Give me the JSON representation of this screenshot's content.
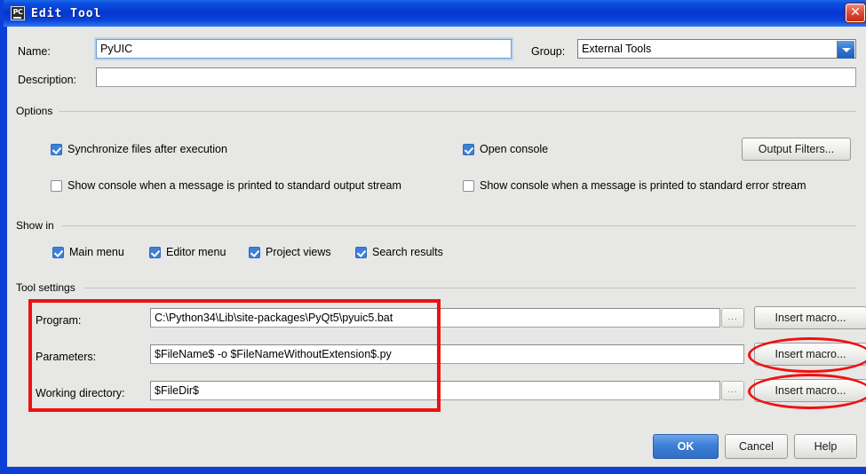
{
  "window": {
    "title": "Edit Tool",
    "icon": "pycharm-icon",
    "close_label": "✕",
    "accent_blue": "#0a3fd8",
    "annotation_color": "#ee1111"
  },
  "form": {
    "name_label": "Name:",
    "name_value": "PyUIC",
    "group_label": "Group:",
    "group_value": "External Tools",
    "description_label": "Description:",
    "description_value": ""
  },
  "options": {
    "title": "Options",
    "items": [
      {
        "label": "Synchronize files after execution",
        "checked": true
      },
      {
        "label": "Open console",
        "checked": true
      },
      {
        "label": "Show console when a message is printed to standard output stream",
        "checked": false
      },
      {
        "label": "Show console when a message is printed to standard error stream",
        "checked": false
      }
    ],
    "output_filters_label": "Output Filters..."
  },
  "show_in": {
    "title": "Show in",
    "items": [
      {
        "label": "Main menu",
        "checked": true
      },
      {
        "label": "Editor menu",
        "checked": true
      },
      {
        "label": "Project views",
        "checked": true
      },
      {
        "label": "Search results",
        "checked": true
      }
    ]
  },
  "tool_settings": {
    "title": "Tool settings",
    "rows": [
      {
        "label": "Program:",
        "value": "C:\\Python34\\Lib\\site-packages\\PyQt5\\pyuic5.bat",
        "browse_label": "...",
        "has_browse": true,
        "macro_label": "Insert macro...",
        "highlighted": false
      },
      {
        "label": "Parameters:",
        "value": "$FileName$ -o $FileNameWithoutExtension$.py",
        "browse_label": "",
        "has_browse": false,
        "macro_label": "Insert macro...",
        "highlighted": true
      },
      {
        "label": "Working directory:",
        "value": "$FileDir$",
        "browse_label": "...",
        "has_browse": true,
        "macro_label": "Insert macro...",
        "highlighted": true
      }
    ]
  },
  "footer": {
    "ok_label": "OK",
    "cancel_label": "Cancel",
    "help_label": "Help"
  }
}
